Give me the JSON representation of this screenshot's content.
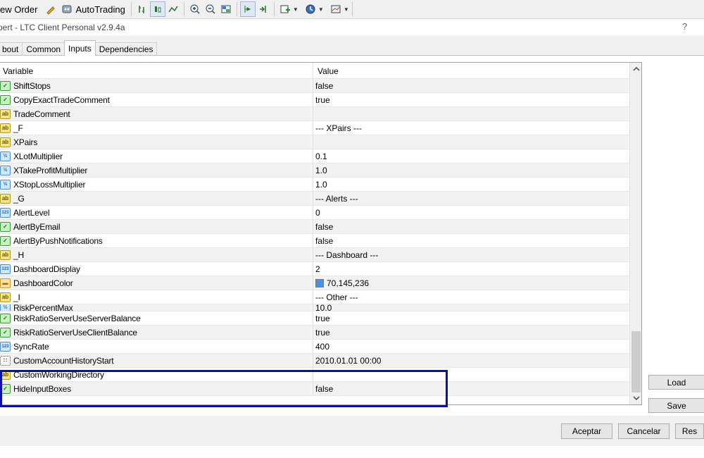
{
  "toolbar": {
    "new_order_label": "ew Order",
    "autotrading_label": "AutoTrading"
  },
  "window": {
    "title": "pert - LTC Client Personal v2.9.4a",
    "help": "?"
  },
  "tabs": [
    {
      "label": "bout"
    },
    {
      "label": "Common"
    },
    {
      "label": "Inputs",
      "active": true
    },
    {
      "label": "Dependencies"
    }
  ],
  "grid": {
    "header_variable": "Variable",
    "header_value": "Value",
    "rows": [
      {
        "type": "bool",
        "name": "ShiftStops",
        "value": "false"
      },
      {
        "type": "bool",
        "name": "CopyExactTradeComment",
        "value": "true"
      },
      {
        "type": "str",
        "name": "TradeComment",
        "value": ""
      },
      {
        "type": "str",
        "name": "_F",
        "value": "--- XPairs ---"
      },
      {
        "type": "str",
        "name": "XPairs",
        "value": ""
      },
      {
        "type": "dbl",
        "name": "XLotMultiplier",
        "value": "0.1"
      },
      {
        "type": "dbl",
        "name": "XTakeProfitMultiplier",
        "value": "1.0"
      },
      {
        "type": "dbl",
        "name": "XStopLossMultiplier",
        "value": "1.0"
      },
      {
        "type": "str",
        "name": "_G",
        "value": "--- Alerts ---"
      },
      {
        "type": "int",
        "name": "AlertLevel",
        "value": "0"
      },
      {
        "type": "bool",
        "name": "AlertByEmail",
        "value": "false"
      },
      {
        "type": "bool",
        "name": "AlertByPushNotifications",
        "value": "false"
      },
      {
        "type": "str",
        "name": "_H",
        "value": "--- Dashboard ---"
      },
      {
        "type": "int",
        "name": "DashboardDisplay",
        "value": "2"
      },
      {
        "type": "color",
        "name": "DashboardColor",
        "value": "70,145,236",
        "swatch": "#4691ec"
      },
      {
        "type": "str",
        "name": "_I",
        "value": "--- Other ---"
      },
      {
        "type": "dbl",
        "name": "RiskPercentMax",
        "value": "10.0",
        "partial": true
      },
      {
        "type": "bool",
        "name": "RiskRatioServerUseServerBalance",
        "value": "true"
      },
      {
        "type": "bool",
        "name": "RiskRatioServerUseClientBalance",
        "value": "true"
      },
      {
        "type": "int",
        "name": "SyncRate",
        "value": "400"
      },
      {
        "type": "date",
        "name": "CustomAccountHistoryStart",
        "value": "2010.01.01 00:00"
      },
      {
        "type": "str",
        "name": "CustomWorkingDirectory",
        "value": ""
      },
      {
        "type": "bool",
        "name": "HideInputBoxes",
        "value": "false"
      }
    ]
  },
  "icon_glyphs": {
    "bool": "✓",
    "str": "ab",
    "dbl": "½",
    "int": "123",
    "color": "▬",
    "date": "∷"
  },
  "buttons": {
    "load": "Load",
    "save": "Save",
    "accept": "Aceptar",
    "cancel": "Cancelar",
    "reset": "Res"
  }
}
